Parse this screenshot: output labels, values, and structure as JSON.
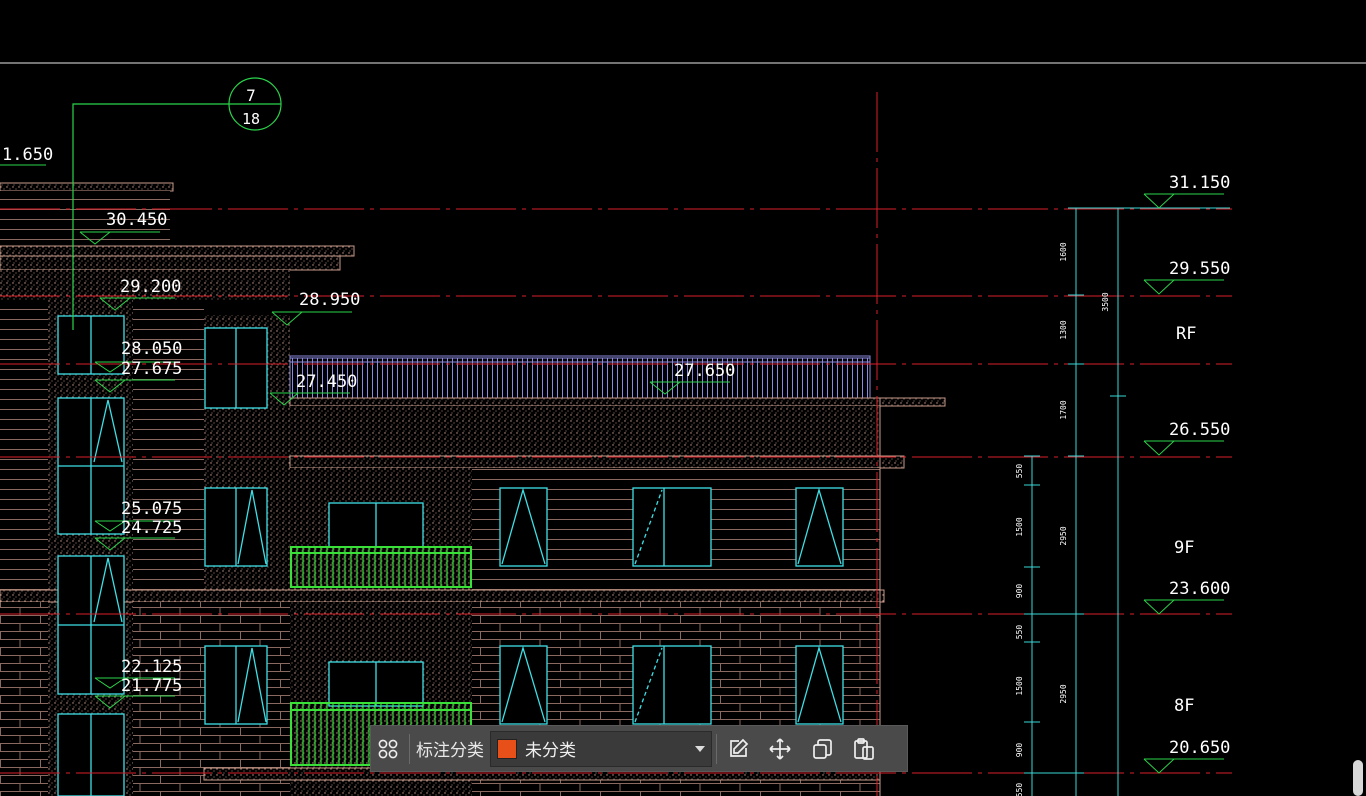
{
  "drawing": {
    "detail_callout": {
      "top": "7",
      "bottom": "18"
    },
    "elevations_left": [
      {
        "name": "elev-1650",
        "text": "1.650"
      },
      {
        "name": "elev-30450",
        "text": "30.450"
      },
      {
        "name": "elev-29200",
        "text": "29.200"
      },
      {
        "name": "elev-28950",
        "text": "28.950"
      },
      {
        "name": "elev-28050",
        "text": "28.050"
      },
      {
        "name": "elev-27675",
        "text": "27.675"
      },
      {
        "name": "elev-27450",
        "text": "27.450"
      },
      {
        "name": "elev-27650",
        "text": "27.650"
      },
      {
        "name": "elev-25075",
        "text": "25.075"
      },
      {
        "name": "elev-24725",
        "text": "24.725"
      },
      {
        "name": "elev-22125",
        "text": "22.125"
      },
      {
        "name": "elev-21775",
        "text": "21.775"
      }
    ],
    "elevations_right": [
      {
        "name": "elev-31150",
        "text": "31.150"
      },
      {
        "name": "elev-29550",
        "text": "29.550"
      },
      {
        "name": "elev-26550",
        "text": "26.550"
      },
      {
        "name": "elev-23600",
        "text": "23.600"
      },
      {
        "name": "elev-20650",
        "text": "20.650"
      }
    ],
    "floor_labels": [
      {
        "name": "floor-label-rf",
        "text": "RF"
      },
      {
        "name": "floor-label-9f",
        "text": "9F"
      },
      {
        "name": "floor-label-8f",
        "text": "8F"
      }
    ],
    "dimensions_outer": [
      {
        "name": "dim-1600",
        "text": "1600"
      },
      {
        "name": "dim-1300",
        "text": "1300"
      },
      {
        "name": "dim-1700",
        "text": "1700"
      },
      {
        "name": "dim-2950-a",
        "text": "2950"
      },
      {
        "name": "dim-2950-b",
        "text": "2950"
      },
      {
        "name": "dim-3500",
        "text": "3500"
      }
    ],
    "dimensions_inner": [
      {
        "name": "dim-550-a",
        "text": "550"
      },
      {
        "name": "dim-1500-a",
        "text": "1500"
      },
      {
        "name": "dim-900-a",
        "text": "900"
      },
      {
        "name": "dim-550-b",
        "text": "550"
      },
      {
        "name": "dim-1500-b",
        "text": "1500"
      },
      {
        "name": "dim-900-b",
        "text": "900"
      },
      {
        "name": "dim-550-c",
        "text": "550"
      }
    ]
  },
  "toolbar": {
    "label": "标注分类",
    "category_value": "未分类",
    "category_color": "#e8501a",
    "icons": [
      "grid-icon",
      "edit-icon",
      "move-icon",
      "copy-icon",
      "paste-icon"
    ]
  },
  "colors": {
    "axis_red": "#d9202a",
    "wall": "#c89a8a",
    "window_cyan": "#3de0e6",
    "railing_green": "#38e038",
    "parapet_blue": "#8a8ae0",
    "dim_cyan": "#3ad8d8",
    "elev_green": "#2ad44a"
  }
}
